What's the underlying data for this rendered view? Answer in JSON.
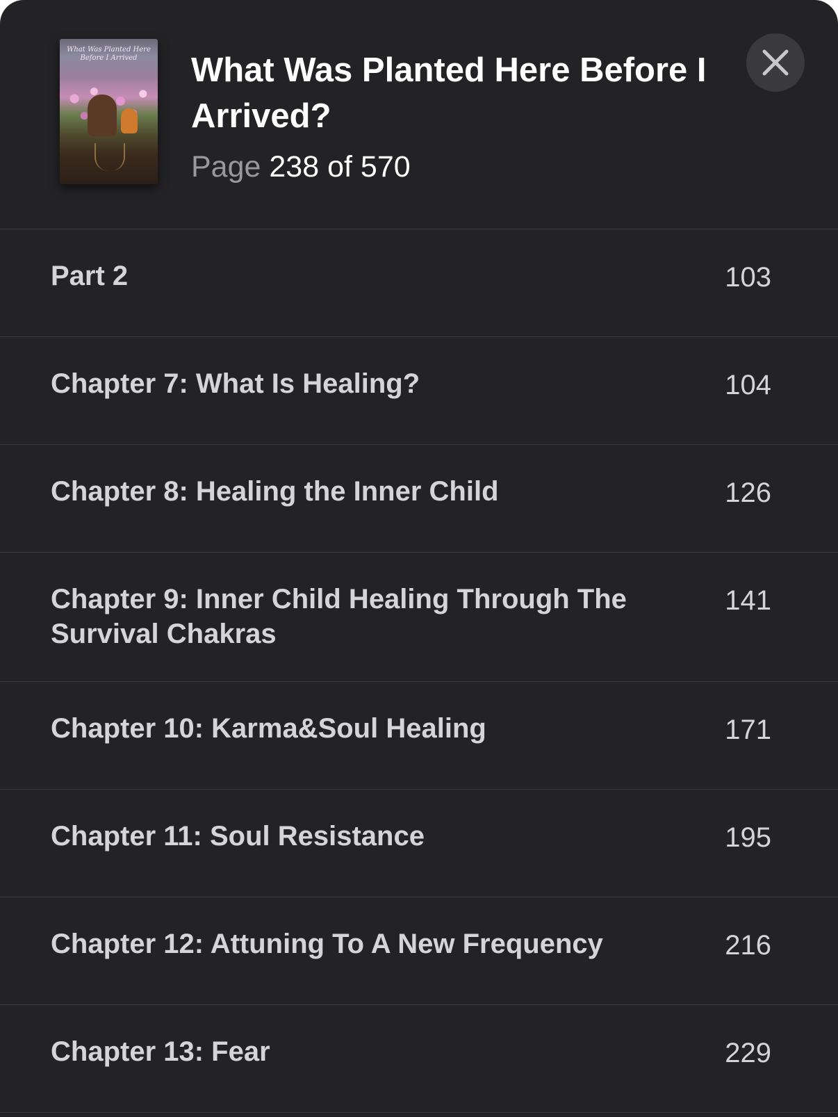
{
  "book": {
    "title": "What Was Planted Here Before I Arrived?",
    "page_label": "Page",
    "current_page": "238",
    "page_of_label": "of",
    "total_pages": "570",
    "cover_script_text": "What Was Planted Here Before I Arrived"
  },
  "toc": [
    {
      "title": "Part 2",
      "page": "103"
    },
    {
      "title": "Chapter 7: What Is Healing?",
      "page": "104"
    },
    {
      "title": "Chapter 8: Healing the Inner Child",
      "page": "126"
    },
    {
      "title": "Chapter 9: Inner Child Healing Through The Survival Chakras",
      "page": "141"
    },
    {
      "title": "Chapter 10: Karma&Soul Healing",
      "page": "171"
    },
    {
      "title": "Chapter 11: Soul Resistance",
      "page": "195"
    },
    {
      "title": "Chapter 12: Attuning To A New Frequency",
      "page": "216"
    },
    {
      "title": "Chapter 13: Fear",
      "page": "229"
    }
  ],
  "icons": {
    "close": "close-icon"
  },
  "colors": {
    "background": "#232325",
    "separator": "#3a3a3c",
    "close_button_bg": "#3a3a3d",
    "primary_text": "#ffffff",
    "secondary_text": "#98989d",
    "row_text": "#d5d5d8"
  }
}
